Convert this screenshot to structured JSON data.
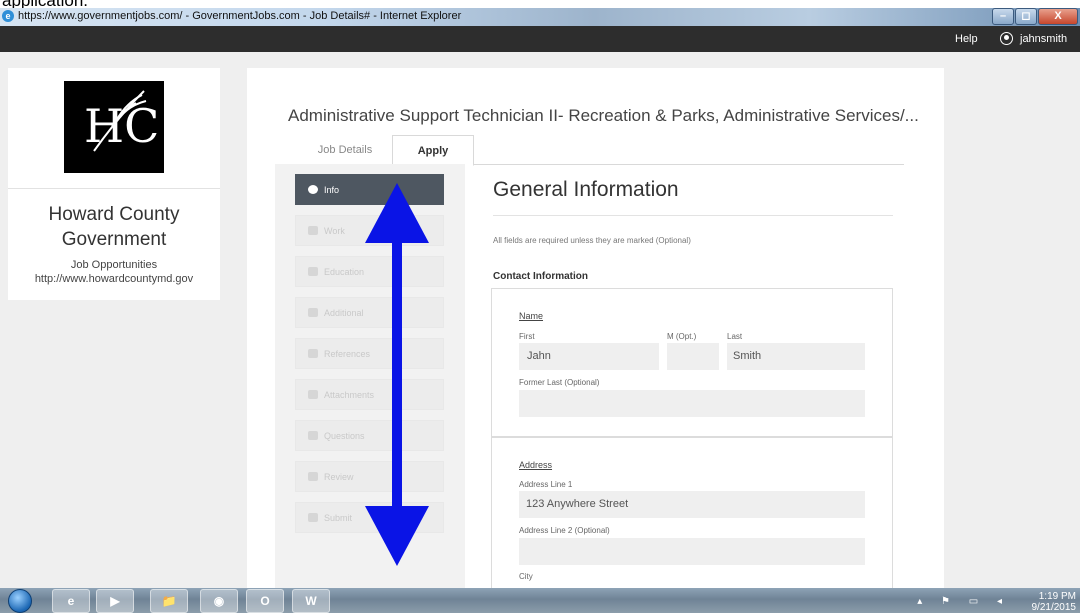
{
  "caption": "application.",
  "window": {
    "title": "https://www.governmentjobs.com/ - GovernmentJobs.com - Job Details# - Internet Explorer",
    "buttons": {
      "minimize": "–",
      "maximize": "◻",
      "close": "X"
    }
  },
  "appbar": {
    "help": "Help",
    "user": "jahnsmith"
  },
  "agency": {
    "logo_text": "HC",
    "name_line1": "Howard County",
    "name_line2": "Government",
    "sub_line1": "Job Opportunities",
    "sub_line2": "http://www.howardcountymd.gov"
  },
  "job": {
    "title": "Administrative Support Technician II- Recreation & Parks, Administrative Services/...",
    "tabs": [
      {
        "label": "Job Details",
        "active": false
      },
      {
        "label": "Apply",
        "active": true
      }
    ]
  },
  "nav": {
    "items": [
      {
        "label": "Info",
        "icon": "info-icon",
        "active": true
      },
      {
        "label": "Work",
        "icon": "briefcase-icon",
        "active": false
      },
      {
        "label": "Education",
        "icon": "book-icon",
        "active": false
      },
      {
        "label": "Additional",
        "icon": "ellipsis-icon",
        "active": false
      },
      {
        "label": "References",
        "icon": "speech-bubble-icon",
        "active": false
      },
      {
        "label": "Attachments",
        "icon": "paperclip-icon",
        "active": false
      },
      {
        "label": "Questions",
        "icon": "question-icon",
        "active": false
      },
      {
        "label": "Review",
        "icon": "review-icon",
        "active": false
      },
      {
        "label": "Submit",
        "icon": "checkbox-icon",
        "active": false
      }
    ]
  },
  "form": {
    "heading": "General Information",
    "note": "All fields are required unless they are marked (Optional)",
    "contact_heading": "Contact Information",
    "name": {
      "section": "Name",
      "first_label": "First",
      "first_value": "Jahn",
      "middle_label": "M (Opt.)",
      "middle_value": "",
      "last_label": "Last",
      "last_value": "Smith",
      "former_label": "Former Last (Optional)",
      "former_value": ""
    },
    "address": {
      "section": "Address",
      "line1_label": "Address Line 1",
      "line1_value": "123 Anywhere Street",
      "line2_label": "Address Line 2 (Optional)",
      "line2_value": "",
      "city_label": "City"
    }
  },
  "annotation": {
    "color": "#0a14e6"
  },
  "taskbar": {
    "apps": [
      "e",
      "▶",
      "📁",
      "◉",
      "O",
      "W"
    ],
    "time": "1:19 PM",
    "date": "9/21/2015"
  }
}
